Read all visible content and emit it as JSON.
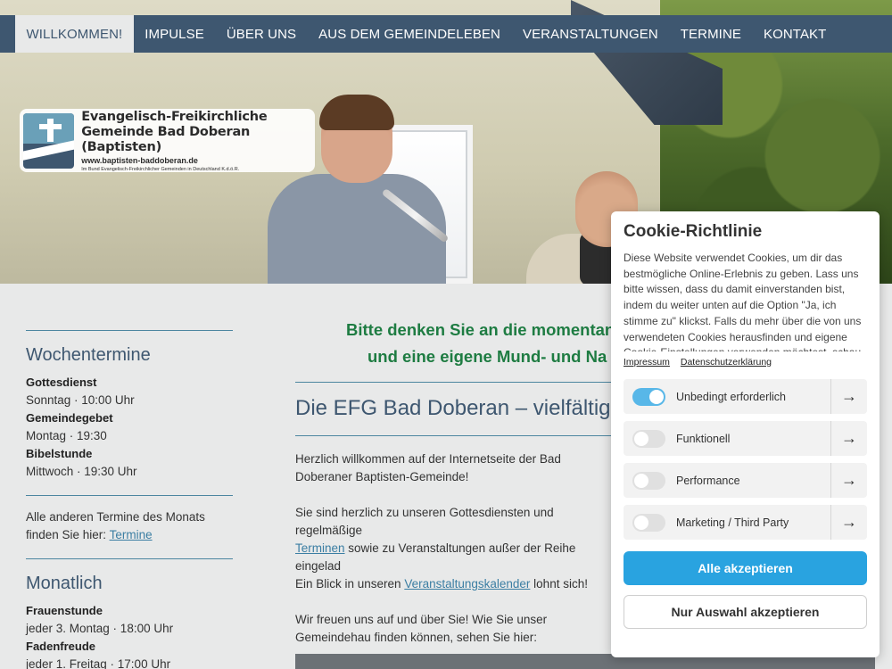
{
  "nav": {
    "items": [
      "WILLKOMMEN!",
      "IMPULSE",
      "ÜBER UNS",
      "AUS DEM GEMEINDELEBEN",
      "VERANSTALTUNGEN",
      "TERMINE",
      "KONTAKT"
    ]
  },
  "logo": {
    "line1": "Evangelisch-Freikirchliche",
    "line2": "Gemeinde Bad Doberan (Baptisten)",
    "url": "www.baptisten-baddoberan.de",
    "tagline": "Im Bund Evangelisch-Freikirchlicher Gemeinden in Deutschland K.d.ö.R."
  },
  "sidebar": {
    "weekly_heading": "Wochentermine",
    "weekly": [
      {
        "title": "Gottesdienst",
        "value": "Sonntag · 10:00 Uhr"
      },
      {
        "title": "Gemeindegebet",
        "value": "Montag · 19:30"
      },
      {
        "title": "Bibelstunde",
        "value": "Mittwoch · 19:30 Uhr"
      }
    ],
    "other_text": "Alle anderen Termine des Monats finden Sie hier:",
    "other_link": "Termine",
    "monthly_heading": "Monatlich",
    "monthly": [
      {
        "title": "Frauenstunde",
        "value": "jeder 3. Montag · 18:00 Uhr"
      },
      {
        "title": "Fadenfreude",
        "value": "jeder 1. Freitag · 17:00 Uhr"
      }
    ]
  },
  "main": {
    "notice_line1": "Bitte denken Sie an die momentan",
    "notice_line2": "und eine eigene Mund- und Na",
    "heading": "Die EFG Bad Doberan – vielfältig",
    "p1": "Herzlich willkommen auf der Internetseite der Bad Doberaner Baptisten-Gemeinde!",
    "p2_pre": "Sie sind herzlich zu unseren Gottesdiensten und regelmäßige",
    "p2_link1": "Terminen",
    "p2_mid": " sowie zu Veranstaltungen außer der Reihe eingelad",
    "p2_line3_pre": "Ein Blick in unseren ",
    "p2_link2": "Veranstaltungskalender",
    "p2_post": " lohnt sich!",
    "p3": "Wir freuen uns auf und über Sie! Wie Sie unser Gemeindehau finden können, sehen Sie hier:"
  },
  "cookie": {
    "title": "Cookie-Richtlinie",
    "description": "Diese Website verwendet Cookies, um dir das bestmögliche Online-Erlebnis zu geben. Lass uns bitte wissen, dass du damit einverstanden bist, indem du weiter unten auf die Option \"Ja, ich stimme zu\" klickst. Falls du mehr über die von uns verwendeten Cookies herausfinden und eigene Cookie-Einstellungen verwenden möchtest, schau",
    "link_impressum": "Impressum",
    "link_privacy": "Datenschutzerklärung",
    "options": [
      {
        "label": "Unbedingt erforderlich",
        "enabled": true
      },
      {
        "label": "Funktionell",
        "enabled": false
      },
      {
        "label": "Performance",
        "enabled": false
      },
      {
        "label": "Marketing / Third Party",
        "enabled": false
      }
    ],
    "accept_all": "Alle akzeptieren",
    "accept_selection": "Nur Auswahl akzeptieren",
    "arrow_icon": "arrow-right-icon",
    "accent_color": "#29a3e0"
  }
}
